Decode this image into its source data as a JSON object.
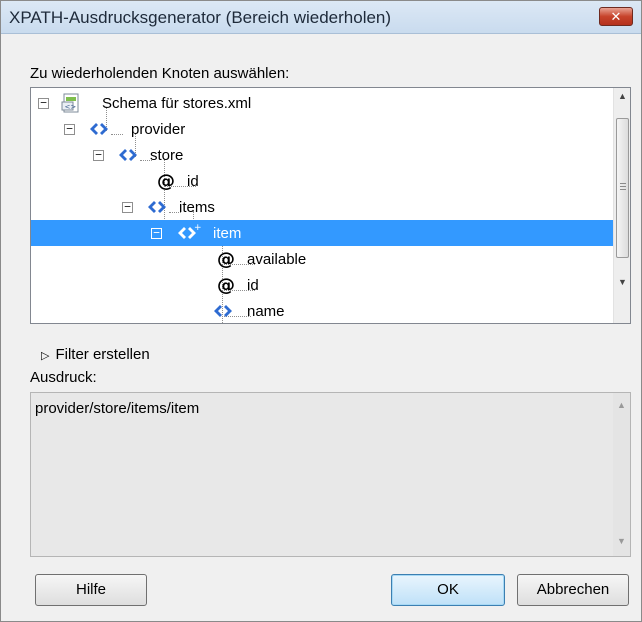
{
  "dialog": {
    "title": "XPATH-Ausdrucksgenerator (Bereich wiederholen)",
    "close_glyph": "✕"
  },
  "tree_section": {
    "label": "Zu wiederholenden Knoten auswählen:",
    "nodes": [
      {
        "text": "Schema für stores.xml",
        "icon": "schema-file-icon",
        "expander": "−"
      },
      {
        "text": "provider",
        "icon": "element-icon",
        "expander": "−"
      },
      {
        "text": "store",
        "icon": "element-icon",
        "expander": "−"
      },
      {
        "text": "id",
        "icon": "attribute-icon",
        "glyph": "@"
      },
      {
        "text": "items",
        "icon": "element-icon",
        "expander": "−"
      },
      {
        "text": "item",
        "icon": "repeating-element-icon",
        "expander": "−",
        "selected": true
      },
      {
        "text": "available",
        "icon": "attribute-icon",
        "glyph": "@"
      },
      {
        "text": "id",
        "icon": "attribute-icon",
        "glyph": "@"
      },
      {
        "text": "name",
        "icon": "element-icon"
      }
    ],
    "selection_color": "#3399ff"
  },
  "filter": {
    "label": "Filter erstellen",
    "glyph": "▷"
  },
  "expression": {
    "label": "Ausdruck:",
    "value": "provider/store/items/item"
  },
  "scroll_glyphs": {
    "up": "▲",
    "down": "▼"
  },
  "buttons": {
    "help": "Hilfe",
    "ok": "OK",
    "cancel": "Abbrechen"
  }
}
